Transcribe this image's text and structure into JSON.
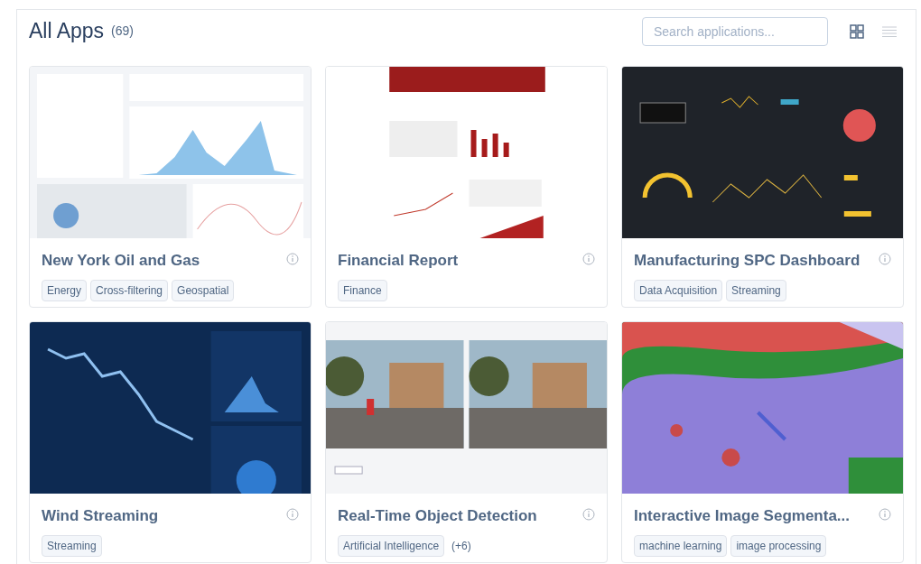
{
  "header": {
    "title": "All Apps",
    "count": "(69)",
    "search": {
      "placeholder": "Search applications..."
    },
    "views": [
      {
        "kind": "grid",
        "selected": true
      },
      {
        "kind": "list",
        "selected": false
      }
    ]
  },
  "apps": [
    {
      "title": "New York Oil and Gas",
      "tags": [
        "Energy",
        "Cross-filtering",
        "Geospatial"
      ]
    },
    {
      "title": "Financial Report",
      "tags": [
        "Finance"
      ]
    },
    {
      "title": "Manufacturing SPC Dashboard",
      "tags": [
        "Data Acquisition",
        "Streaming"
      ]
    },
    {
      "title": "Wind Streaming",
      "tags": [
        "Streaming"
      ]
    },
    {
      "title": "Real-Time Object Detection",
      "tags": [
        "Artificial Intelligence"
      ],
      "more": "(+6)"
    },
    {
      "title": "Interactive Image Segmenta...",
      "tags": [
        "machine learning",
        "image processing"
      ]
    }
  ]
}
